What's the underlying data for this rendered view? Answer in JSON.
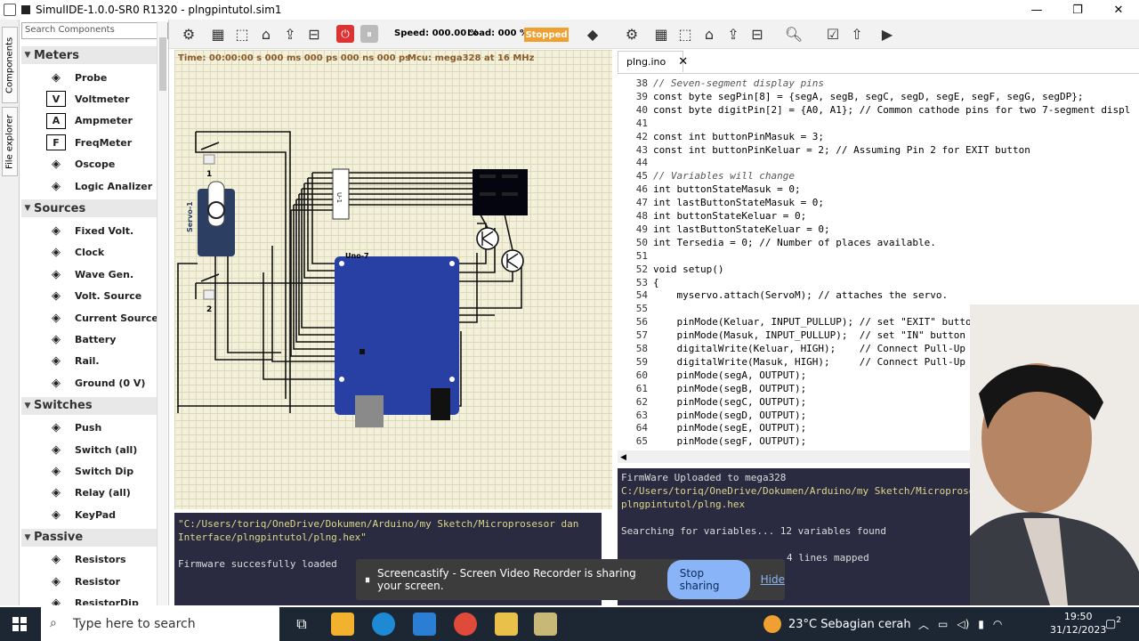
{
  "window": {
    "title": "SimulIDE-1.0.0-SR0 R1320 - plngpintutol.sim1",
    "minimize": "—",
    "maximize": "❐",
    "close": "✕"
  },
  "vtabs": {
    "components": "Components",
    "explorer": "File explorer"
  },
  "search": {
    "placeholder": "Search Components"
  },
  "categories": [
    {
      "label": "Meters",
      "items": [
        {
          "label": "Probe",
          "icon": "probe-icon"
        },
        {
          "label": "Voltmeter",
          "icon": "V"
        },
        {
          "label": "Ampmeter",
          "icon": "A"
        },
        {
          "label": "FreqMeter",
          "icon": "F"
        },
        {
          "label": "Oscope",
          "icon": "oscope-icon"
        },
        {
          "label": "Logic Analizer",
          "icon": "logic-icon"
        }
      ]
    },
    {
      "label": "Sources",
      "items": [
        {
          "label": "Fixed Volt.",
          "icon": "fixed-volt-icon"
        },
        {
          "label": "Clock",
          "icon": "clock-icon"
        },
        {
          "label": "Wave Gen.",
          "icon": "wave-icon"
        },
        {
          "label": "Volt. Source",
          "icon": "volt-source-icon"
        },
        {
          "label": "Current Source",
          "icon": "current-source-icon"
        },
        {
          "label": "Battery",
          "icon": "battery-icon"
        },
        {
          "label": "Rail.",
          "icon": "rail-icon"
        },
        {
          "label": "Ground (0 V)",
          "icon": "ground-icon"
        }
      ]
    },
    {
      "label": "Switches",
      "items": [
        {
          "label": "Push",
          "icon": "push-icon"
        },
        {
          "label": "Switch (all)",
          "icon": "switch-icon"
        },
        {
          "label": "Switch Dip",
          "icon": "dip-icon"
        },
        {
          "label": "Relay (all)",
          "icon": "relay-icon"
        },
        {
          "label": "KeyPad",
          "icon": "keypad-icon"
        }
      ]
    },
    {
      "label": "Passive",
      "items": [
        {
          "label": "Resistors",
          "icon": "resistors-icon"
        },
        {
          "label": "Resistor",
          "icon": "resistor-icon"
        },
        {
          "label": "ResistorDip",
          "icon": "resistordip-icon"
        }
      ]
    }
  ],
  "toolbar": {
    "speed": "Speed: 000.00 %",
    "load": "Load: 000 %",
    "state": "Stopped"
  },
  "circuit": {
    "time": "Time: 00:00:00 s  000 ms  000 ps  000 ns  000 ps",
    "mcu": "Mcu: mega328 at 16 MHz",
    "servo": "Servo-1",
    "uno": "Uno-7",
    "sw1": "1",
    "sw2": "2",
    "res_label": "Uno-7"
  },
  "editor": {
    "tab": "plng.ino",
    "lines": [
      {
        "n": "38",
        "t": "// Seven-segment display pins",
        "c": true
      },
      {
        "n": "39",
        "t": "const byte segPin[8] = {segA, segB, segC, segD, segE, segF, segG, segDP};"
      },
      {
        "n": "40",
        "t": "const byte digitPin[2] = {A0, A1}; // Common cathode pins for two 7-segment displ"
      },
      {
        "n": "41",
        "t": ""
      },
      {
        "n": "42",
        "t": "const int buttonPinMasuk = 3;"
      },
      {
        "n": "43",
        "t": "const int buttonPinKeluar = 2; // Assuming Pin 2 for EXIT button"
      },
      {
        "n": "44",
        "t": ""
      },
      {
        "n": "45",
        "t": "// Variables will change",
        "c": true
      },
      {
        "n": "46",
        "t": "int buttonStateMasuk = 0;"
      },
      {
        "n": "47",
        "t": "int lastButtonStateMasuk = 0;"
      },
      {
        "n": "48",
        "t": "int buttonStateKeluar = 0;"
      },
      {
        "n": "49",
        "t": "int lastButtonStateKeluar = 0;"
      },
      {
        "n": "50",
        "t": "int Tersedia = 0; // Number of places available."
      },
      {
        "n": "51",
        "t": ""
      },
      {
        "n": "52",
        "t": "void setup()"
      },
      {
        "n": "53",
        "t": "{"
      },
      {
        "n": "54",
        "t": "    myservo.attach(ServoM); // attaches the servo."
      },
      {
        "n": "55",
        "t": ""
      },
      {
        "n": "56",
        "t": "    pinMode(Keluar, INPUT_PULLUP); // set \"EXIT\" butto"
      },
      {
        "n": "57",
        "t": "    pinMode(Masuk, INPUT_PULLUP);  // set \"IN\" button"
      },
      {
        "n": "58",
        "t": "    digitalWrite(Keluar, HIGH);    // Connect Pull-Up"
      },
      {
        "n": "59",
        "t": "    digitalWrite(Masuk, HIGH);     // Connect Pull-Up"
      },
      {
        "n": "60",
        "t": "    pinMode(segA, OUTPUT);"
      },
      {
        "n": "61",
        "t": "    pinMode(segB, OUTPUT);"
      },
      {
        "n": "62",
        "t": "    pinMode(segC, OUTPUT);"
      },
      {
        "n": "63",
        "t": "    pinMode(segD, OUTPUT);"
      },
      {
        "n": "64",
        "t": "    pinMode(segE, OUTPUT);"
      },
      {
        "n": "65",
        "t": "    pinMode(segF, OUTPUT);"
      }
    ]
  },
  "console_left": {
    "l1": " \"C:/Users/toriq/OneDrive/Dokumen/Arduino/my Sketch/Microprosesor dan",
    "l2": "Interface/plngpintutol/plng.hex\"",
    "l3": "Firmware succesfully loaded"
  },
  "console_right": {
    "l1": "FirmWare Uploaded to mega328",
    "l2": "C:/Users/toriq/OneDrive/Dokumen/Arduino/my Sketch/Microprose",
    "l3": "plngpintutol/plng.hex",
    "l4": "Searching for variables... 12 variables found",
    "l5": "4 lines mapped"
  },
  "cast": {
    "text": "Screencastify - Screen Video Recorder is sharing your screen.",
    "stop": "Stop sharing",
    "hide": "Hide"
  },
  "taskbar": {
    "search": "Type here to search",
    "weather": "23°C  Sebagian cerah",
    "time": "19:50",
    "date": "31/12/2023",
    "notif": "2"
  }
}
